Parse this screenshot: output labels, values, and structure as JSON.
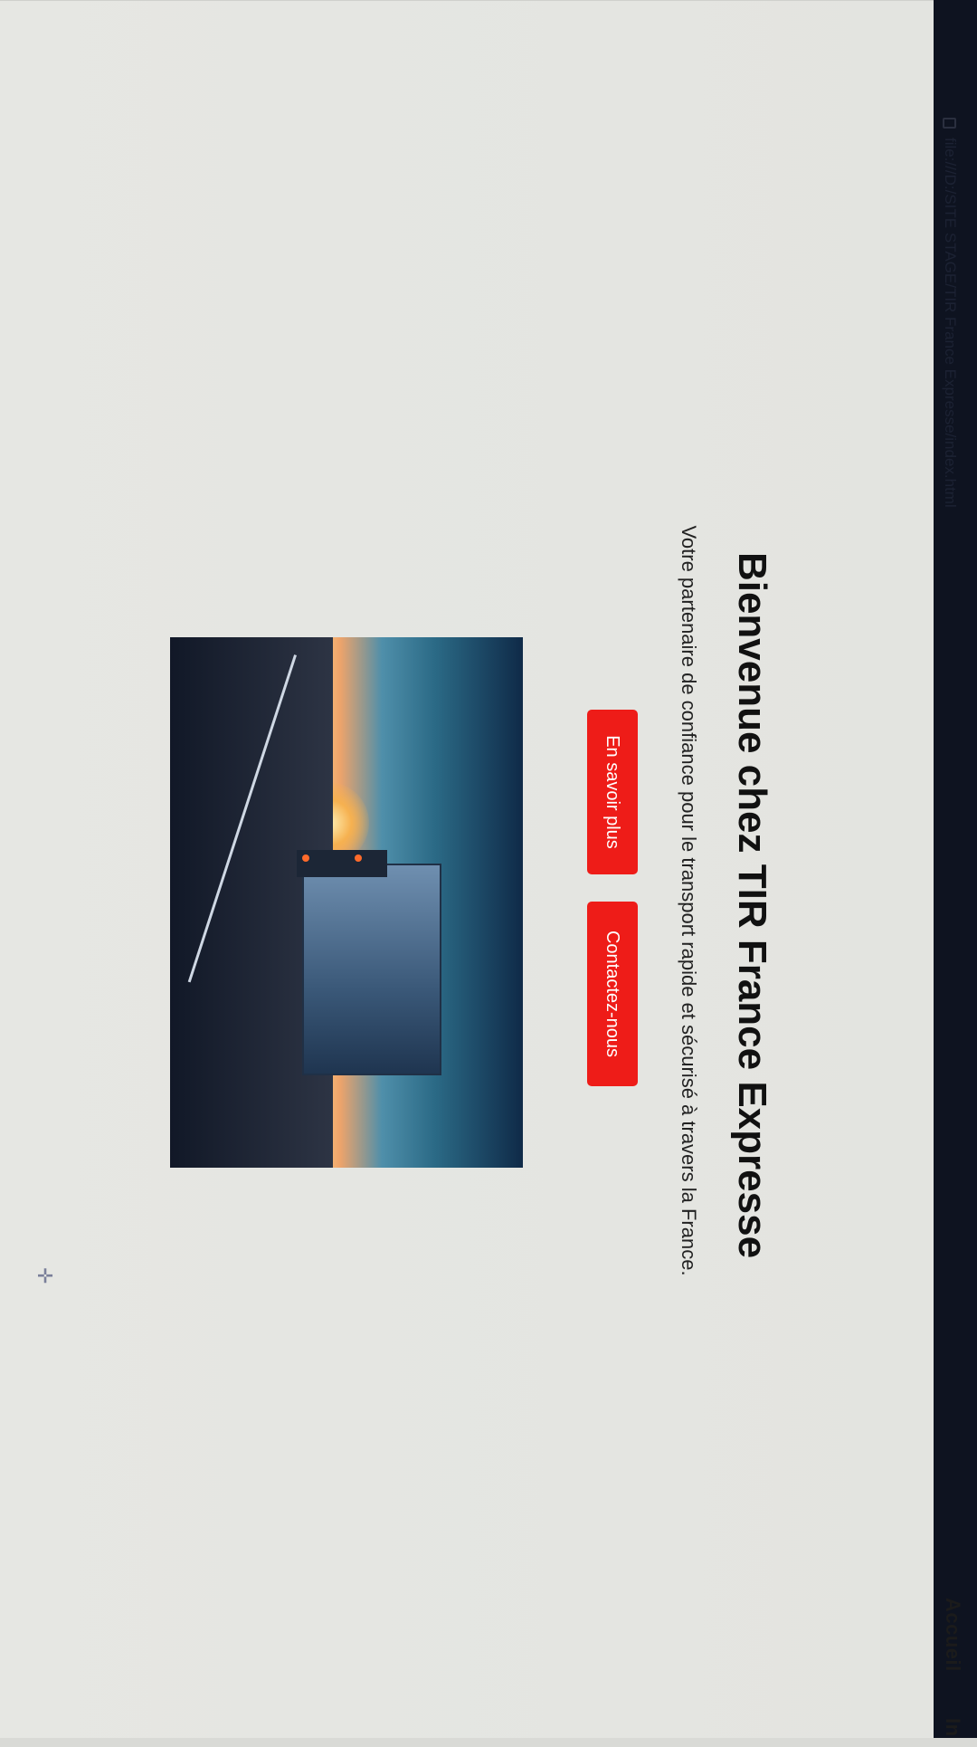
{
  "browser": {
    "address": "file:///D:/SITE STAGE/TIR France Expresse/index.html"
  },
  "nav": {
    "items": [
      "Accueil",
      "In"
    ]
  },
  "hero": {
    "title": "Bienvenue chez TIR France Expresse",
    "subtitle": "Votre partenaire de confiance pour le transport rapide et sécurisé à travers la France.",
    "buttons": [
      "En savoir plus",
      "Contactez-nous"
    ],
    "button_color": "#ee1c18",
    "image": "truck-on-highway-at-sunset"
  }
}
